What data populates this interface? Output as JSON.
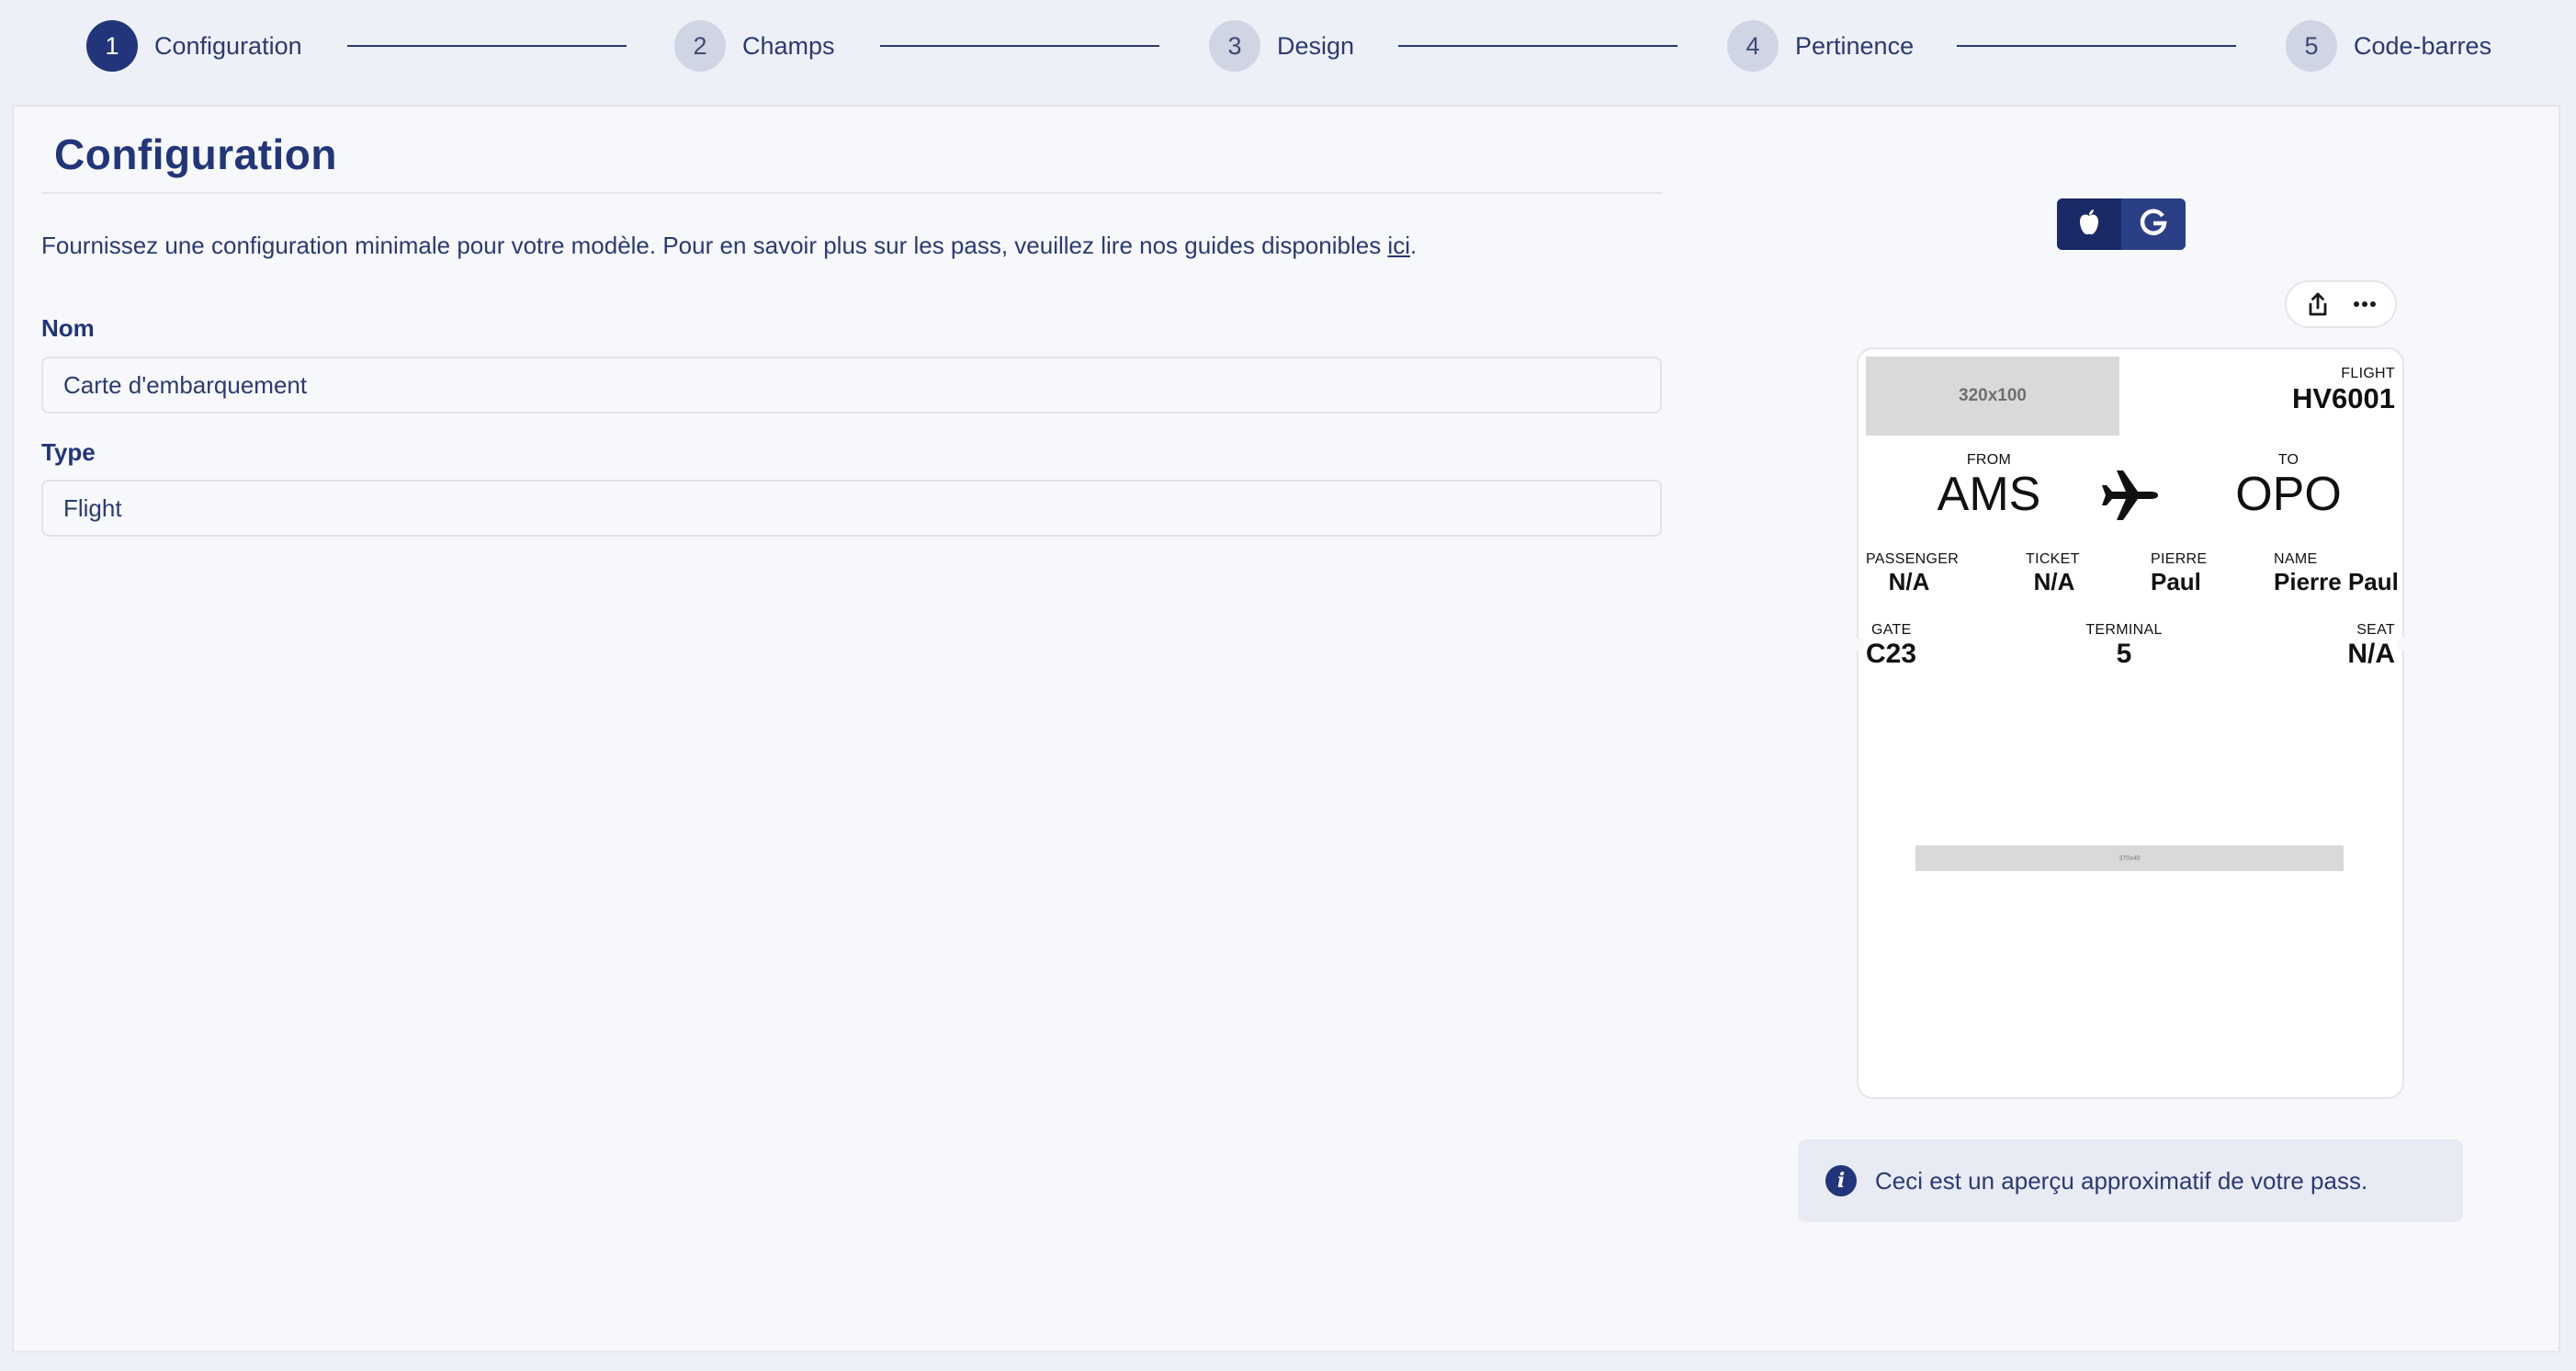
{
  "stepper": {
    "steps": [
      {
        "number": "1",
        "label": "Configuration",
        "active": true
      },
      {
        "number": "2",
        "label": "Champs",
        "active": false
      },
      {
        "number": "3",
        "label": "Design",
        "active": false
      },
      {
        "number": "4",
        "label": "Pertinence",
        "active": false
      },
      {
        "number": "5",
        "label": "Code-barres",
        "active": false
      }
    ]
  },
  "main": {
    "title": "Configuration",
    "description_prefix": "Fournissez une configuration minimale pour votre modèle. Pour en savoir plus sur les pass, veuillez lire nos guides disponibles ",
    "description_link": "ici",
    "description_suffix": ".",
    "fields": {
      "name": {
        "label": "Nom",
        "value": "Carte d'embarquement"
      },
      "type": {
        "label": "Type",
        "value": "Flight"
      }
    }
  },
  "preview": {
    "platforms": [
      {
        "name": "apple",
        "icon": "apple-icon",
        "selected": true
      },
      {
        "name": "google",
        "icon": "google-icon",
        "selected": false
      }
    ],
    "actions": [
      {
        "icon": "share-icon"
      },
      {
        "icon": "more-icon"
      }
    ],
    "pass": {
      "logo_placeholder": "320x100",
      "flight_label": "FLIGHT",
      "flight_value": "HV6001",
      "from_label": "FROM",
      "from_value": "AMS",
      "to_label": "TO",
      "to_value": "OPO",
      "plane_icon": "plane-icon",
      "secondary": [
        {
          "label": "PASSENGER",
          "value": "N/A"
        },
        {
          "label": "TICKET",
          "value": "N/A"
        },
        {
          "label": "PIERRE",
          "value": "Paul"
        },
        {
          "label": "NAME",
          "value": "Pierre Paul"
        }
      ],
      "auxiliary": [
        {
          "label": "GATE",
          "value": "C23"
        },
        {
          "label": "TERMINAL",
          "value": "5"
        },
        {
          "label": "SEAT",
          "value": "N/A"
        }
      ],
      "barcode_placeholder": "370x40"
    },
    "info_text": "Ceci est un aperçu approximatif de votre pass."
  },
  "colors": {
    "primary": "#22357a",
    "page_background": "#edf0f7",
    "panel_background": "#f7f8fb",
    "step_inactive": "#cfd5e3",
    "placeholder_gray": "#d9d9d9"
  }
}
